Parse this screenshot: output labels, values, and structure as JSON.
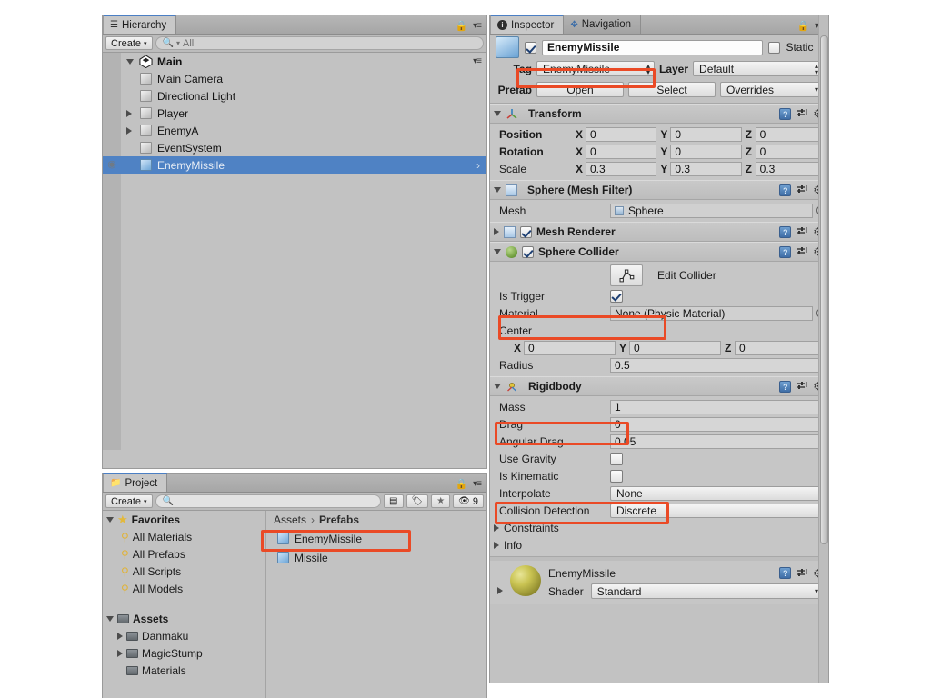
{
  "hierarchy": {
    "tab_label": "Hierarchy",
    "tab_icon": "hierarchy-icon",
    "create_label": "Create",
    "search_placeholder": "All",
    "scene_name": "Main",
    "items": [
      {
        "label": "Main Camera",
        "indent": 2,
        "expandable": false,
        "selected": false
      },
      {
        "label": "Directional Light",
        "indent": 2,
        "expandable": false,
        "selected": false
      },
      {
        "label": "Player",
        "indent": 2,
        "expandable": true,
        "selected": false
      },
      {
        "label": "EnemyA",
        "indent": 2,
        "expandable": true,
        "selected": false
      },
      {
        "label": "EventSystem",
        "indent": 2,
        "expandable": false,
        "selected": false
      },
      {
        "label": "EnemyMissile",
        "indent": 2,
        "expandable": false,
        "selected": true
      }
    ]
  },
  "project": {
    "tab_label": "Project",
    "create_label": "Create",
    "search_placeholder": "",
    "hidden_count": "9",
    "favorites_label": "Favorites",
    "favorites": [
      {
        "label": "All Materials"
      },
      {
        "label": "All Prefabs"
      },
      {
        "label": "All Scripts"
      },
      {
        "label": "All Models"
      }
    ],
    "assets_label": "Assets",
    "folders": [
      {
        "label": "Danmaku",
        "expandable": true
      },
      {
        "label": "MagicStump",
        "expandable": true
      },
      {
        "label": "Materials",
        "expandable": false
      }
    ],
    "breadcrumb": [
      "Assets",
      "Prefabs"
    ],
    "assets": [
      {
        "label": "EnemyMissile",
        "highlighted": true
      },
      {
        "label": "Missile",
        "highlighted": false
      }
    ]
  },
  "inspector": {
    "tabs": [
      {
        "label": "Inspector",
        "icon": "info-icon",
        "active": true
      },
      {
        "label": "Navigation",
        "icon": "navigation-icon",
        "active": false
      }
    ],
    "object_name": "EnemyMissile",
    "object_enabled": true,
    "static_label": "Static",
    "static_checked": false,
    "tag_label": "Tag",
    "tag_value": "EnemyMissile",
    "layer_label": "Layer",
    "layer_value": "Default",
    "prefab_label": "Prefab",
    "prefab_open": "Open",
    "prefab_select": "Select",
    "prefab_overrides": "Overrides",
    "transform": {
      "title": "Transform",
      "rows": [
        {
          "label": "Position",
          "bold": true,
          "x": "0",
          "y": "0",
          "z": "0"
        },
        {
          "label": "Rotation",
          "bold": true,
          "x": "0",
          "y": "0",
          "z": "0"
        },
        {
          "label": "Scale",
          "bold": false,
          "x": "0.3",
          "y": "0.3",
          "z": "0.3"
        }
      ]
    },
    "mesh_filter": {
      "title": "Sphere (Mesh Filter)",
      "mesh_label": "Mesh",
      "mesh_value": "Sphere"
    },
    "mesh_renderer": {
      "title": "Mesh Renderer",
      "enabled": true,
      "expanded": false
    },
    "sphere_collider": {
      "title": "Sphere Collider",
      "enabled": true,
      "edit_collider_label": "Edit Collider",
      "is_trigger_label": "Is Trigger",
      "is_trigger_checked": true,
      "material_label": "Material",
      "material_value": "None (Physic Material)",
      "center_label": "Center",
      "center_x": "0",
      "center_y": "0",
      "center_z": "0",
      "radius_label": "Radius",
      "radius_value": "0.5"
    },
    "rigidbody": {
      "title": "Rigidbody",
      "mass_label": "Mass",
      "mass_value": "1",
      "drag_label": "Drag",
      "drag_value": "0",
      "angular_drag_label": "Angular Drag",
      "angular_drag_value": "0.05",
      "use_gravity_label": "Use Gravity",
      "use_gravity_checked": false,
      "is_kinematic_label": "Is Kinematic",
      "is_kinematic_checked": false,
      "interpolate_label": "Interpolate",
      "interpolate_value": "None",
      "collision_detection_label": "Collision Detection",
      "collision_detection_value": "Discrete",
      "constraints_label": "Constraints",
      "info_label": "Info"
    },
    "material": {
      "name": "EnemyMissile",
      "shader_label": "Shader",
      "shader_value": "Standard"
    }
  },
  "annotations": {
    "color": "#ea4a26",
    "boxes": [
      "tag-field",
      "is-trigger-row",
      "rigidbody-header",
      "use-gravity-row",
      "project-enemymissile-asset"
    ]
  }
}
